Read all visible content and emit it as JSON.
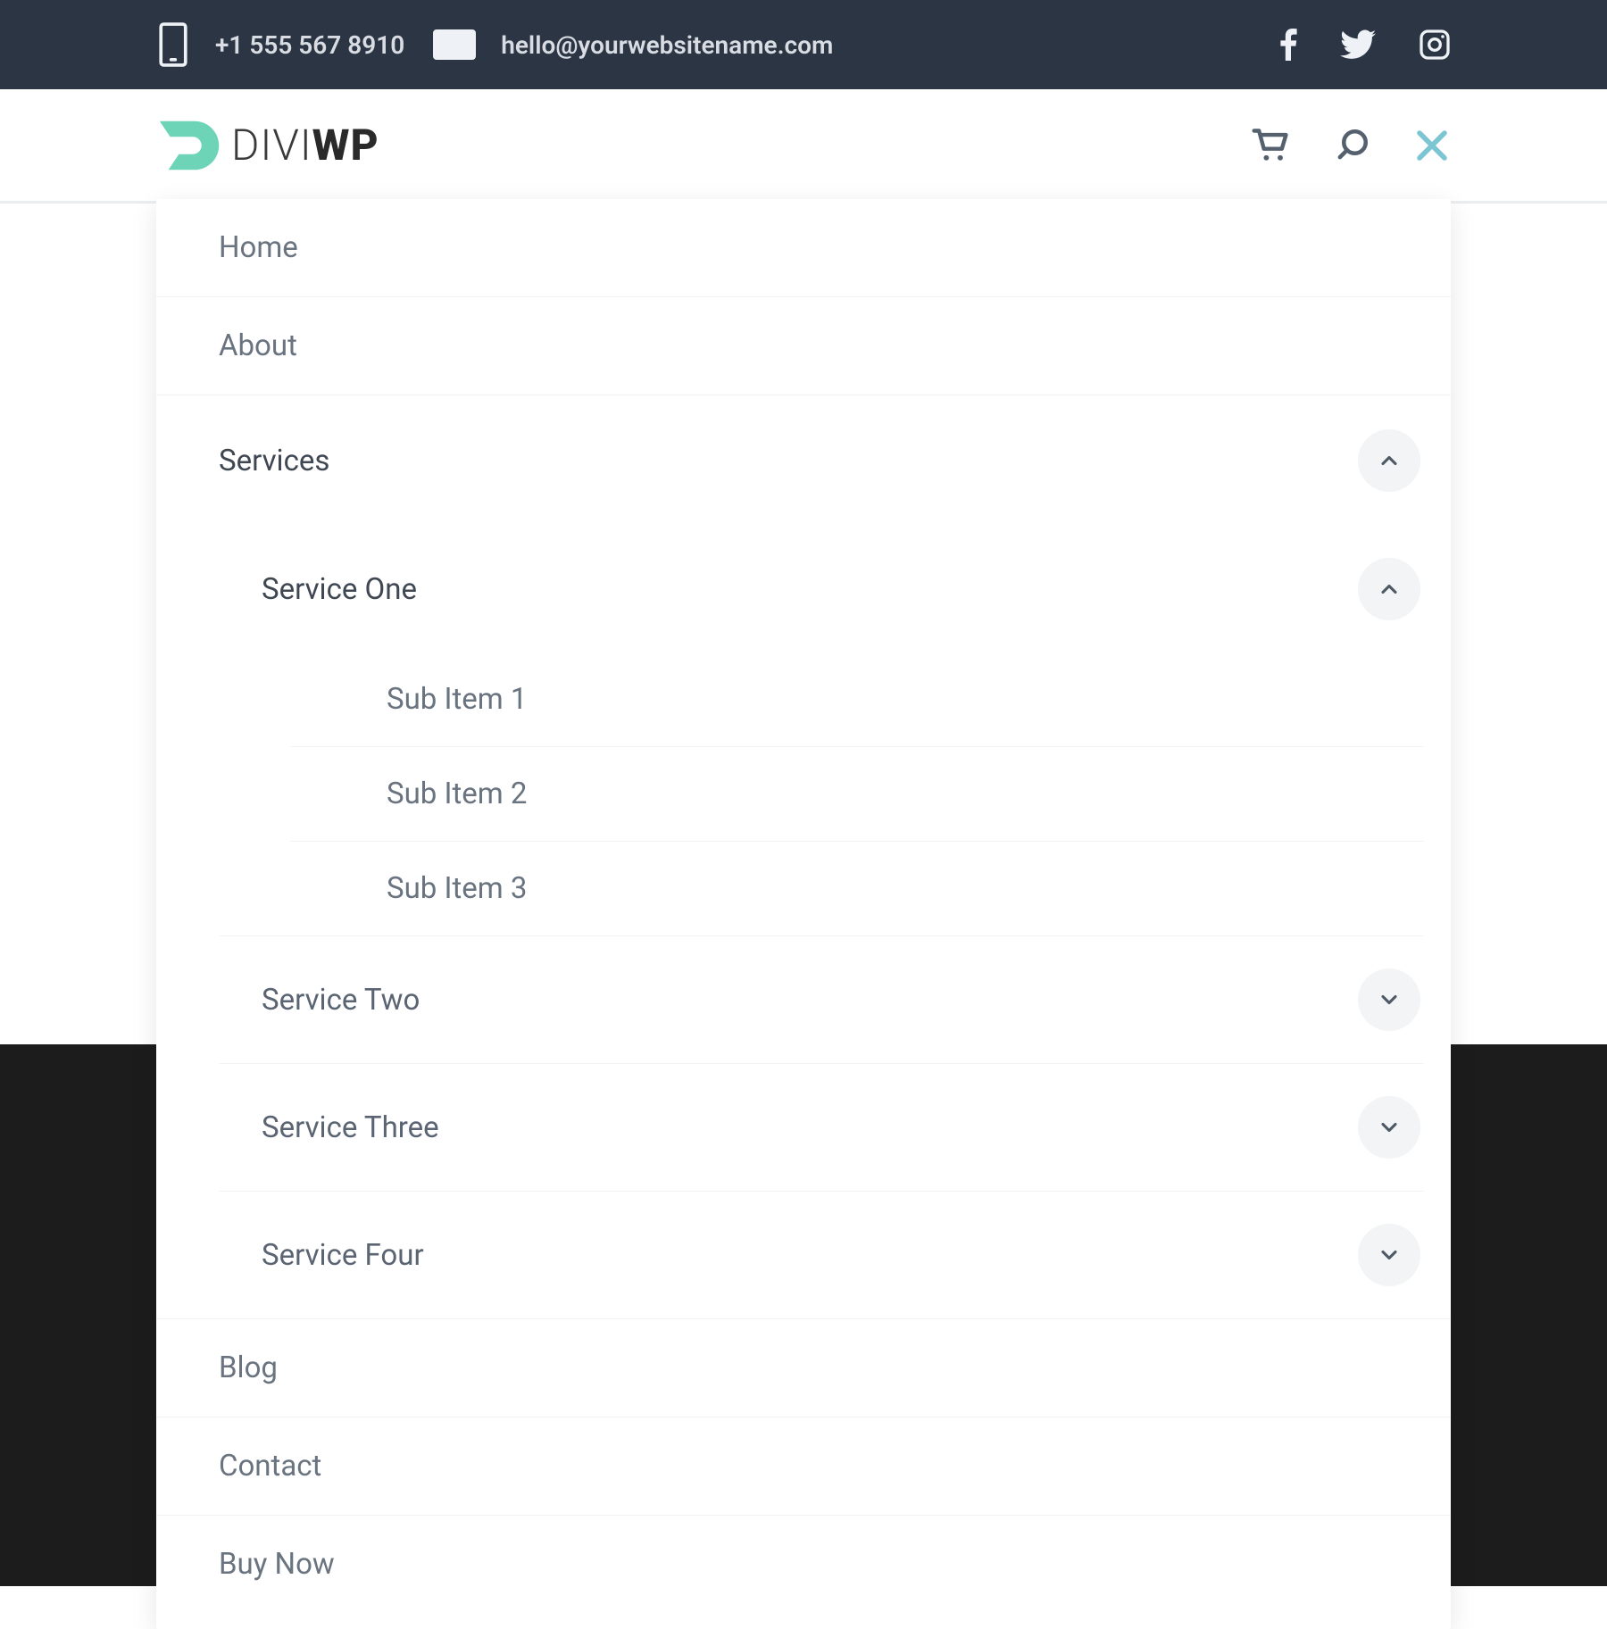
{
  "topbar": {
    "phone": "+1 555 567 8910",
    "email": "hello@yourwebsitename.com"
  },
  "logo": {
    "part1": "DIVI",
    "part2": "WP"
  },
  "menu": {
    "home": "Home",
    "about": "About",
    "services": "Services",
    "service_one": "Service One",
    "sub1": "Sub Item 1",
    "sub2": "Sub Item 2",
    "sub3": "Sub Item 3",
    "service_two": "Service Two",
    "service_three": "Service Three",
    "service_four": "Service Four",
    "blog": "Blog",
    "contact": "Contact",
    "buy_now": "Buy Now"
  }
}
